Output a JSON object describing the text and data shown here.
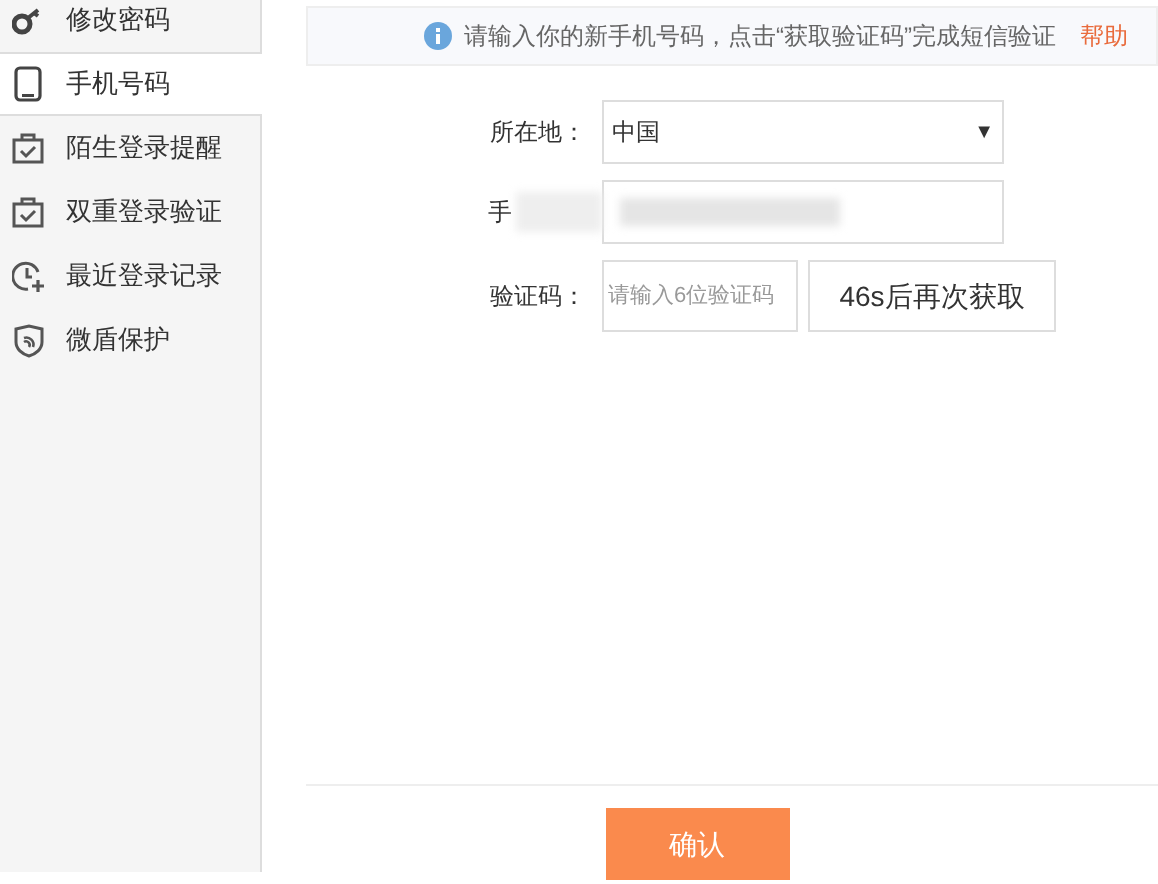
{
  "sidebar": {
    "items": [
      {
        "label": "修改密码",
        "kind": "key",
        "selected": false
      },
      {
        "label": "手机号码",
        "kind": "phone",
        "selected": true
      },
      {
        "label": "陌生登录提醒",
        "kind": "bag",
        "selected": false
      },
      {
        "label": "双重登录验证",
        "kind": "bag",
        "selected": false
      },
      {
        "label": "最近登录记录",
        "kind": "clock",
        "selected": false
      },
      {
        "label": "微盾保护",
        "kind": "shield",
        "selected": false
      }
    ]
  },
  "notice": {
    "text": "请输入你的新手机号码，点击“获取验证码”完成短信验证",
    "link": "帮助"
  },
  "form": {
    "location": {
      "label": "所在地：",
      "value": "中国",
      "caret": "▼"
    },
    "phone": {
      "label": "手"
    },
    "code": {
      "label": "验证码：",
      "placeholder": "请输入6位验证码",
      "button": "46s后再次获取"
    }
  },
  "confirm_button": "确认"
}
